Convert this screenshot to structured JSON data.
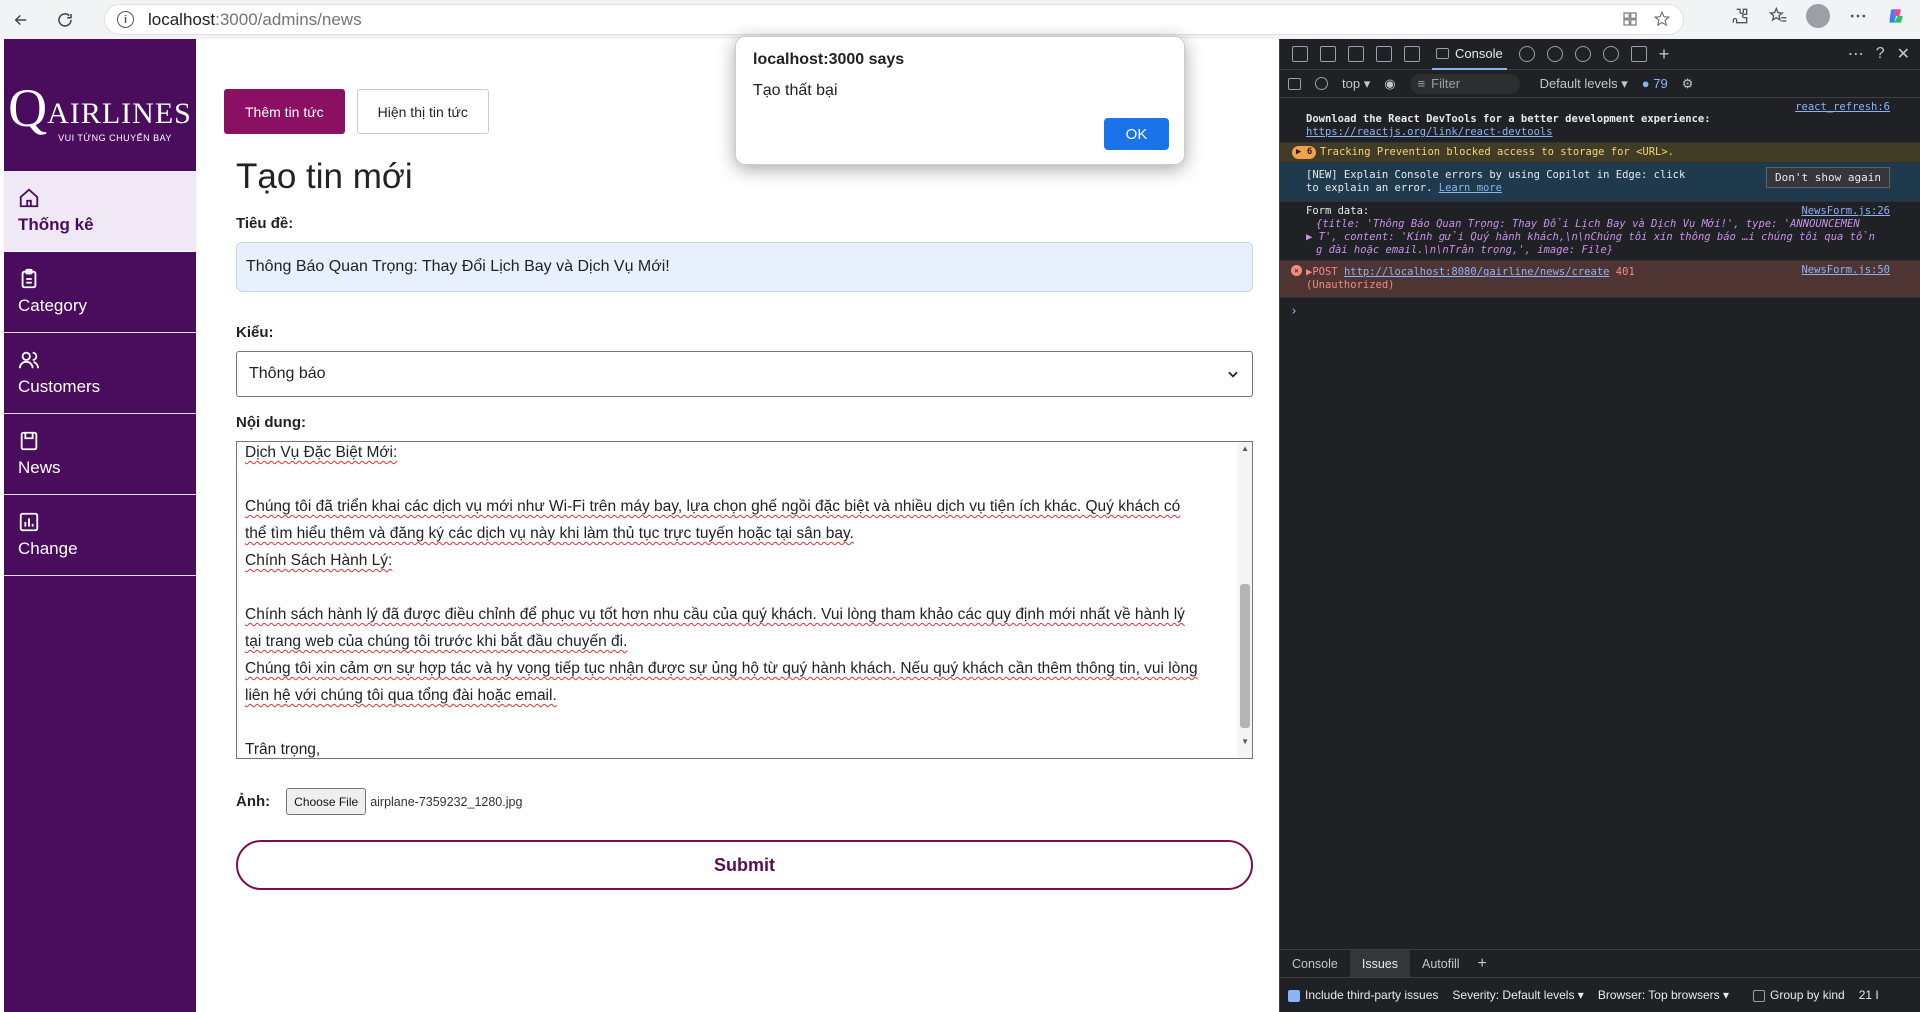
{
  "browser": {
    "url_host": "localhost",
    "url_path": ":3000/admins/news"
  },
  "sidebar": {
    "logo_text": "AIRLINES",
    "logo_letter": "Q",
    "logo_sub": "VUI TỪNG CHUYẾN BAY",
    "items": [
      {
        "label": "Thống kê",
        "icon": "home-icon"
      },
      {
        "label": "Category",
        "icon": "clipboard-icon"
      },
      {
        "label": "Customers",
        "icon": "users-icon"
      },
      {
        "label": "News",
        "icon": "save-icon"
      },
      {
        "label": "Change",
        "icon": "bar-chart-icon"
      }
    ]
  },
  "tabs": {
    "add": "Thêm tin tức",
    "show": "Hiện thị tin tức"
  },
  "form": {
    "heading": "Tạo tin mới",
    "title_label": "Tiêu đề:",
    "title_value": "Thông Báo Quan Trọng: Thay Đổi Lịch Bay và Dịch Vụ Mới!",
    "type_label": "Kiểu:",
    "type_value": "Thông báo",
    "content_label": "Nội dung:",
    "content_lines": [
      "Dịch Vụ Đặc Biệt Mới:",
      "",
      "Chúng tôi đã triển khai các dịch vụ mới như Wi-Fi trên máy bay, lựa chọn ghế ngồi đặc biệt và nhiều dịch vụ tiện ích khác. Quý khách có",
      "thể tìm hiểu thêm và đăng ký các dịch vụ này khi làm thủ tục trực tuyến hoặc tại sân bay.",
      "Chính Sách Hành Lý:",
      "",
      "Chính sách hành lý đã được điều chỉnh để phục vụ tốt hơn nhu cầu của quý khách. Vui lòng tham khảo các quy định mới nhất về hành lý",
      "tại trang web của chúng tôi trước khi bắt đầu chuyến đi.",
      "Chúng tôi xin cảm ơn sự hợp tác và hy vọng tiếp tục nhận được sự ủng hộ từ quý hành khách. Nếu quý khách cần thêm thông tin, vui lòng",
      "liên hệ với chúng tôi qua tổng đài hoặc email.",
      "",
      "Trân trọng,"
    ],
    "image_label": "Ảnh:",
    "file_button": "Choose File",
    "file_name": "airplane-7359232_1280.jpg",
    "submit": "Submit"
  },
  "alert": {
    "title": "localhost:3000 says",
    "message": "Tạo thất bại",
    "ok": "OK"
  },
  "devtools": {
    "console_tab": "Console",
    "context": "top",
    "filter_placeholder": "Filter",
    "levels": "Default levels",
    "issue_count": "79",
    "logs": {
      "react_msg": "Download the React DevTools for a better development experience:",
      "react_link": "https://reactjs.org/link/react-devtools",
      "react_src": "react_refresh:6",
      "warn_count": "6",
      "warn_msg": "Tracking Prevention blocked access to storage for <URL>.",
      "copilot_msg1": "[NEW] Explain Console errors by using Copilot in Edge: click",
      "copilot_msg2": "to explain an error.",
      "copilot_link": "Learn more",
      "dont_show": "Don't show again",
      "form_label": "Form data:",
      "form_src": "NewsForm.js:26",
      "form_line1": "{title: 'Thông Báo Quan Trọng: Thay Đổi Lịch Bay và Dịch Vụ Mới!', type: 'ANNOUNCEMEN",
      "form_line2": "T', content: 'Kính gửi Quý hành khách,\\n\\nChúng tôi xin thông báo …i chúng tôi qua tổn",
      "form_line3": "g đài hoặc email.\\n\\nTrân trọng,', image: File}",
      "err_method": "POST",
      "err_url": "http://localhost:8080/qairline/news/create",
      "err_code": "401",
      "err_status": "(Unauthorized)",
      "err_src": "NewsForm.js:50"
    },
    "drawer_tabs": [
      "Console",
      "Issues",
      "Autofill"
    ],
    "drawer_bar": {
      "third_party": "Include third-party issues",
      "severity": "Severity: Default levels",
      "browser": "Browser: Top browsers",
      "group": "Group by kind",
      "trailing": "21 I"
    }
  }
}
